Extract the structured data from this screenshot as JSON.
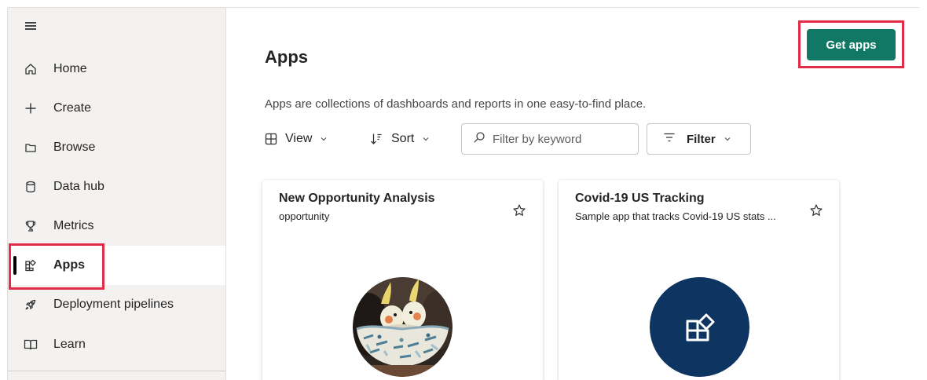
{
  "sidebar": {
    "items": [
      {
        "label": "Home",
        "icon": "home-icon"
      },
      {
        "label": "Create",
        "icon": "plus-icon"
      },
      {
        "label": "Browse",
        "icon": "folder-icon"
      },
      {
        "label": "Data hub",
        "icon": "database-icon"
      },
      {
        "label": "Metrics",
        "icon": "trophy-icon"
      },
      {
        "label": "Apps",
        "icon": "apps-icon",
        "active": true
      },
      {
        "label": "Deployment pipelines",
        "icon": "rocket-icon"
      },
      {
        "label": "Learn",
        "icon": "book-icon"
      }
    ]
  },
  "header": {
    "title": "Apps",
    "description": "Apps are collections of dashboards and reports in one easy-to-find place.",
    "get_apps_label": "Get apps"
  },
  "toolbar": {
    "view_label": "View",
    "sort_label": "Sort",
    "search_placeholder": "Filter by keyword",
    "filter_label": "Filter"
  },
  "cards": [
    {
      "title": "New Opportunity Analysis",
      "subtitle": "opportunity",
      "image": "cockatiel-bird-photo"
    },
    {
      "title": "Covid-19 US Tracking",
      "subtitle": "Sample app that tracks Covid-19 US stats ...",
      "image": "apps-icon"
    }
  ],
  "colors": {
    "accent": "#117865",
    "highlight": "#e32b4a",
    "app_icon_bg": "#0e3461"
  }
}
